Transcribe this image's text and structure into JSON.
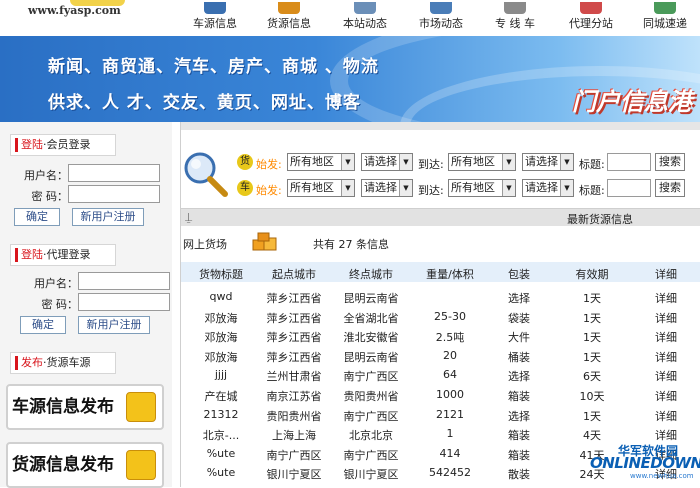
{
  "site": {
    "domain": "www.fyasp.com",
    "colors": {
      "brand_red": "#d8151c",
      "accent_orange": "#ff8a00",
      "header_blue": "#2a6fc4"
    }
  },
  "nav": [
    {
      "label": "车源信息",
      "icon": "truck-icon"
    },
    {
      "label": "货源信息",
      "icon": "cargo-box-icon"
    },
    {
      "label": "本站动态",
      "icon": "news-icon"
    },
    {
      "label": "市场动态",
      "icon": "market-icon"
    },
    {
      "label": "专 线 车",
      "icon": "car-icon"
    },
    {
      "label": "代理分站",
      "icon": "agent-icon"
    },
    {
      "label": "同城速递",
      "icon": "express-icon"
    }
  ],
  "banner": {
    "line1": "新闻、商贸通、汽车、房产、商城 、物流",
    "line2": "供求、人    才、交友、黄页、网址、博客",
    "slogan": "门户信息港"
  },
  "member_login": {
    "head_red": "登陆",
    "head_rest": "·会员登录",
    "username_label": "用户名：",
    "password_label": "密  码：",
    "ok": "确定",
    "register": "新用户注册"
  },
  "agent_login": {
    "head_red": "登陆",
    "head_rest": "·代理登录",
    "username_label": "用户名：",
    "password_label": "密  码：",
    "ok": "确定",
    "register": "新用户注册"
  },
  "publish": {
    "head_red": "发布",
    "head_rest": "·货源车源",
    "vehicle_btn": "车源信息发布",
    "cargo_btn": "货源信息发布"
  },
  "search": {
    "rows": [
      {
        "badge": "货",
        "from_label": "始发:",
        "area1": "所有地区",
        "choose1": "请选择",
        "to_label": "到达:",
        "area2": "所有地区",
        "choose2": "请选择",
        "title_label": "标题:",
        "btn": "搜索"
      },
      {
        "badge": "车",
        "from_label": "始发:",
        "area1": "所有地区",
        "choose1": "请选择",
        "to_label": "到达:",
        "area2": "所有地区",
        "choose2": "请选择",
        "title_label": "标题:",
        "btn": "搜索"
      }
    ]
  },
  "latest_title": "最新货源信息",
  "online_cargo": "网上货场",
  "total_text": "共有 27 条信息",
  "table": {
    "headers": [
      "货物标题",
      "起点城市",
      "终点城市",
      "重量/体积",
      "包装",
      "有效期",
      "详细"
    ],
    "rows": [
      [
        "qwd",
        "萍乡江西省",
        "昆明云南省",
        "",
        "选择",
        "1天",
        "详细"
      ],
      [
        "邓放海",
        "萍乡江西省",
        "全省湖北省",
        "25-30",
        "袋装",
        "1天",
        "详细"
      ],
      [
        "邓放海",
        "萍乡江西省",
        "淮北安徽省",
        "2.5吨",
        "大件",
        "1天",
        "详细"
      ],
      [
        "邓放海",
        "萍乡江西省",
        "昆明云南省",
        "20",
        "桶装",
        "1天",
        "详细"
      ],
      [
        "jjjj",
        "兰州甘肃省",
        "南宁广西区",
        "64",
        "选择",
        "6天",
        "详细"
      ],
      [
        "产在城",
        "南京江苏省",
        "贵阳贵州省",
        "1000",
        "箱装",
        "10天",
        "详细"
      ],
      [
        "21312",
        "贵阳贵州省",
        "南宁广西区",
        "2121",
        "选择",
        "1天",
        "详细"
      ],
      [
        "北京-...",
        "上海上海",
        "北京北京",
        "1",
        "箱装",
        "4天",
        "详细"
      ],
      [
        "%ute",
        "南宁广西区",
        "南宁广西区",
        "414",
        "箱装",
        "41天",
        "详细"
      ],
      [
        "%ute",
        "银川宁夏区",
        "银川宁夏区",
        "542452",
        "散装",
        "24天",
        "详细"
      ]
    ]
  },
  "watermark": {
    "cn": "华军软件园",
    "en": "ONLINEDOWN",
    "url": "www.newhua.com"
  }
}
